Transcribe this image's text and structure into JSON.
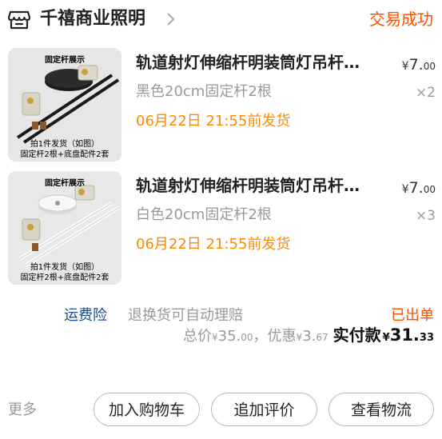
{
  "header": {
    "store_name": "千禧商业照明",
    "order_status": "交易成功"
  },
  "items": [
    {
      "thumb_top_text": "固定杆展示",
      "thumb_bottom_line1": "拍1件发货（如图）",
      "thumb_bottom_line2": "固定杆2根+底盘配件2套",
      "title": "轨道射灯伸缩杆明装筒灯吊杆…",
      "price_currency": "¥",
      "price_int": "7.",
      "price_dec": "00",
      "spec": "黑色20cm固定杆2根",
      "quantity": "×2",
      "ship_time": "06月22日 21:55前发货"
    },
    {
      "thumb_top_text": "固定杆展示",
      "thumb_bottom_line1": "拍1件发货（如图）",
      "thumb_bottom_line2": "固定杆2根+底盘配件2套",
      "title": "轨道射灯伸缩杆明装筒灯吊杆…",
      "price_currency": "¥",
      "price_int": "7.",
      "price_dec": "00",
      "spec": "白色20cm固定杆2根",
      "quantity": "×3",
      "ship_time": "06月22日 21:55前发货"
    }
  ],
  "insurance": {
    "label": "运费险",
    "description": "退换货可自动理赔",
    "status": "已出单"
  },
  "totals": {
    "total_label": "总价",
    "total_currency": "¥",
    "total_int": "35.",
    "total_dec": "00",
    "separator": "，",
    "discount_label": "优惠",
    "discount_currency": "¥",
    "discount_int": "3.",
    "discount_dec": "67",
    "paid_label": "实付款",
    "paid_currency": "¥",
    "paid_int": "31.",
    "paid_dec": "33"
  },
  "actions": {
    "more": "更多",
    "add_cart": "加入购物车",
    "add_review": "追加评价",
    "view_logistics": "查看物流"
  },
  "colors": {
    "accent_orange": "#ff5000",
    "ship_orange": "#ff8a00",
    "insurance_blue": "#1d4a8b"
  }
}
